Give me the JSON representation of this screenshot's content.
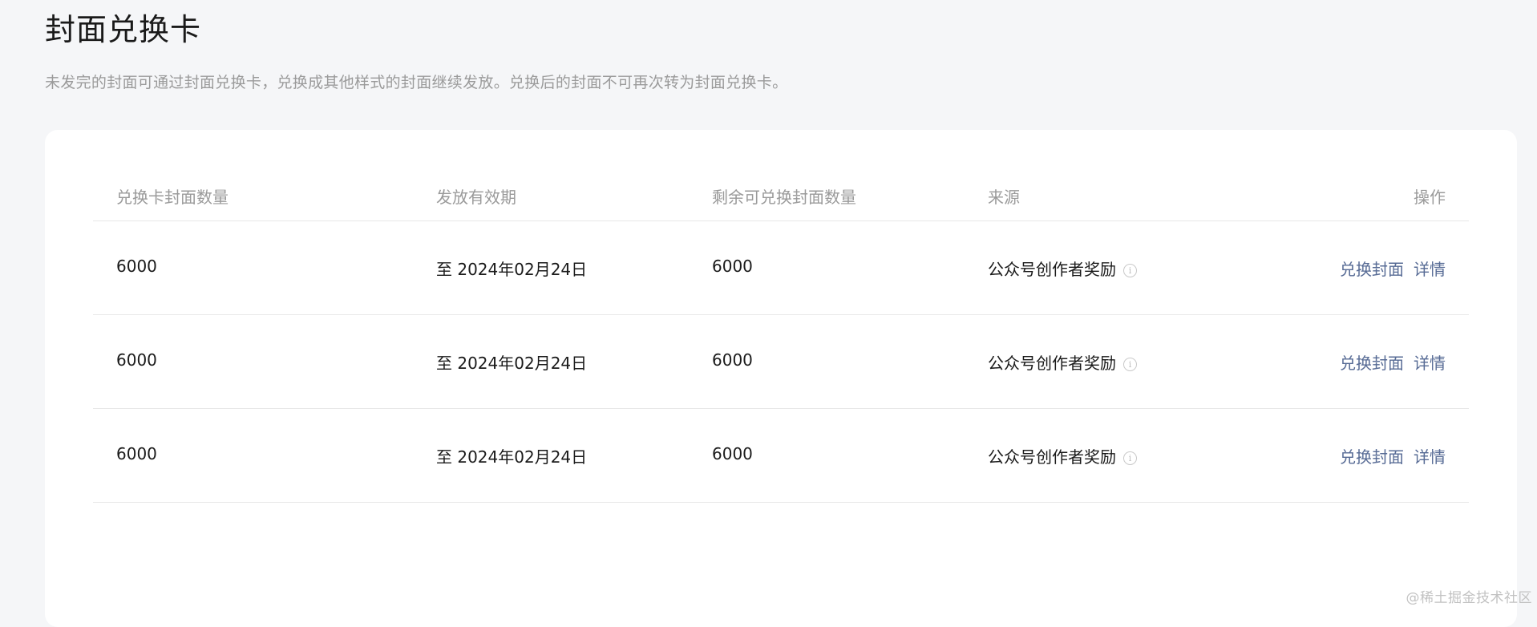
{
  "header": {
    "title": "封面兑换卡",
    "description": "未发完的封面可通过封面兑换卡，兑换成其他样式的封面继续发放。兑换后的封面不可再次转为封面兑换卡。"
  },
  "table": {
    "columns": [
      "兑换卡封面数量",
      "发放有效期",
      "剩余可兑换封面数量",
      "来源",
      "操作"
    ],
    "rows": [
      {
        "quantity": "6000",
        "validity": "至 2024年02月24日",
        "remaining": "6000",
        "source": "公众号创作者奖励",
        "action_exchange": "兑换封面",
        "action_detail": "详情"
      },
      {
        "quantity": "6000",
        "validity": "至 2024年02月24日",
        "remaining": "6000",
        "source": "公众号创作者奖励",
        "action_exchange": "兑换封面",
        "action_detail": "详情"
      },
      {
        "quantity": "6000",
        "validity": "至 2024年02月24日",
        "remaining": "6000",
        "source": "公众号创作者奖励",
        "action_exchange": "兑换封面",
        "action_detail": "详情"
      }
    ],
    "info_icon": "info-circle-icon",
    "info_glyph": "i"
  },
  "watermark": "@稀土掘金技术社区",
  "colors": {
    "background": "#f5f6f8",
    "card": "#ffffff",
    "link": "#576b95",
    "muted_text": "#9a9a9a",
    "divider": "#e8e8e8"
  }
}
